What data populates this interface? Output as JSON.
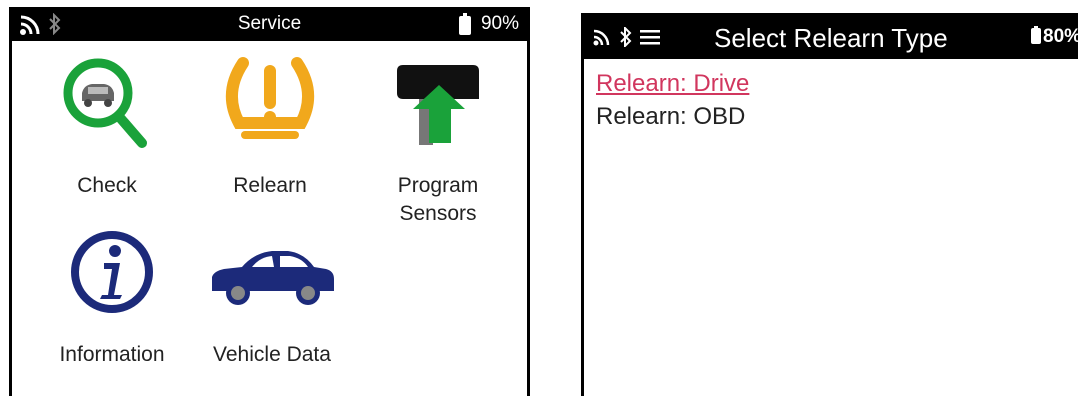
{
  "left_screen": {
    "status_bar": {
      "title": "Service",
      "battery": "90%",
      "icons": [
        "signal-icon",
        "bluetooth-icon",
        "battery-icon"
      ]
    },
    "menu_items": [
      {
        "label": "Check",
        "icon": "magnifier-car-icon",
        "color": "#1aa23a"
      },
      {
        "label": "Relearn",
        "icon": "tire-pressure-warning-icon",
        "color": "#f1a81c"
      },
      {
        "label": "Program Sensors",
        "icon": "sensor-program-icon",
        "color": "#1aa23a"
      },
      {
        "label": "Information",
        "icon": "info-icon",
        "color": "#1c2a7a"
      },
      {
        "label": "Vehicle Data",
        "icon": "car-icon",
        "color": "#1c2a7a"
      }
    ]
  },
  "right_screen": {
    "status_bar": {
      "title": "Select Relearn Type",
      "battery": "80%",
      "icons": [
        "signal-icon",
        "bluetooth-icon",
        "menu-icon",
        "battery-icon"
      ]
    },
    "options": [
      {
        "label": "Relearn: Drive",
        "selected": true
      },
      {
        "label": "Relearn: OBD",
        "selected": false
      }
    ],
    "selected_color": "#d1365e"
  }
}
